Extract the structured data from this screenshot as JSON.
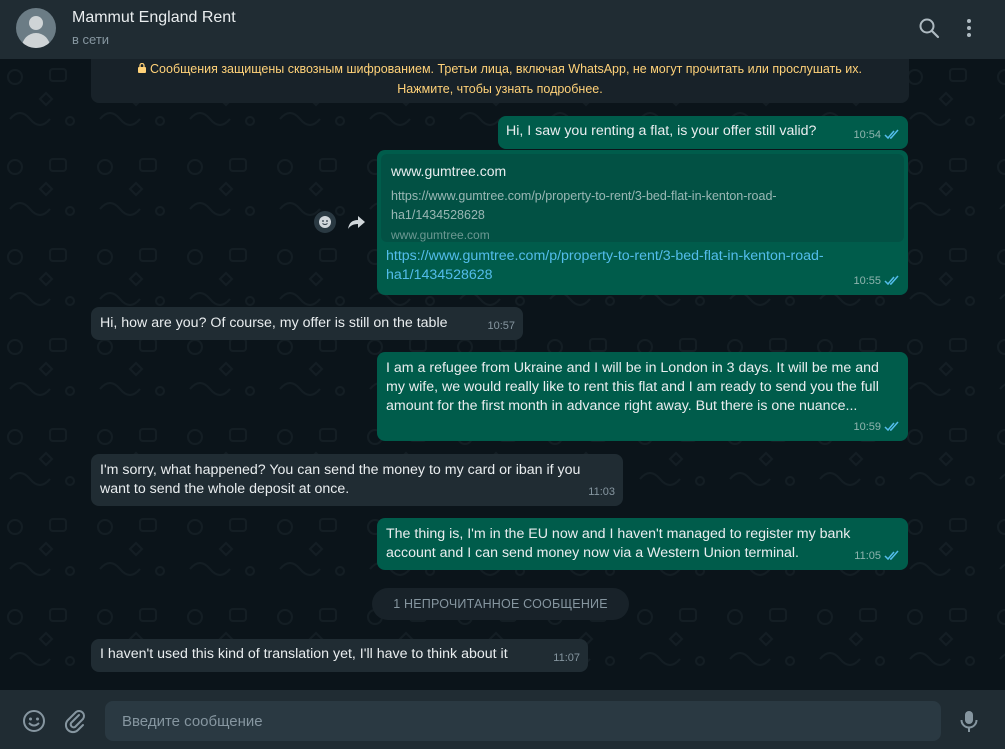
{
  "header": {
    "contact_name": "Mammut England Rent",
    "contact_status": "в сети",
    "icons": [
      "search-icon",
      "menu-icon"
    ]
  },
  "chat": {
    "encryption_notice_line1": "Сообщения защищены сквозным шифрованием. Третьи лица, включая WhatsApp, не могут прочитать или прослушать их.",
    "encryption_notice_line2": "Нажмите, чтобы узнать подробнее.",
    "messages": [
      {
        "direction": "out",
        "text": "Hi, I saw you renting a flat, is your offer still valid?",
        "time": "10:54"
      },
      {
        "direction": "out",
        "type": "link",
        "preview_title": "www.gumtree.com",
        "preview_desc_line1": "https://www.gumtree.com/p/property-to-rent/3-bed-flat-in-kenton-road-",
        "preview_desc_line2": "ha1/1434528628",
        "preview_host": "www.gumtree.com",
        "url_line1": "https://www.gumtree.com/p/property-to-rent/3-bed-flat-in-kenton-road-",
        "url_line2": "ha1/1434528628",
        "time": "10:55"
      },
      {
        "direction": "in",
        "text": "Hi, how are you? Of course, my offer is still on the table",
        "time": "10:57"
      },
      {
        "direction": "out",
        "line1": "I am a refugee from Ukraine and I will be in London in 3 days. It will be me and",
        "line2": "my wife, we would really like to rent this flat and I am ready to send you the full",
        "line3": "amount for the first month in advance right away. But there is one nuance...",
        "time": "10:59"
      },
      {
        "direction": "in",
        "line1": "I'm sorry, what happened? You can send the money to my card or iban if you",
        "line2": "want to send the whole deposit at once.",
        "time": "11:03"
      },
      {
        "direction": "out",
        "line1": "The thing is, I'm in the EU now and I haven't managed to register my bank",
        "line2": "account and I can send money now via a Western Union terminal.",
        "time": "11:05"
      },
      {
        "direction": "in",
        "text": "I haven't used this kind of translation yet, I'll have to think about it",
        "time": "11:07"
      }
    ],
    "unread_divider": "1 НЕПРОЧИТАННОЕ СООБЩЕНИЕ"
  },
  "footer": {
    "placeholder": "Введите сообщение",
    "icons": [
      "emoji-icon",
      "attach-icon",
      "microphone-icon"
    ]
  },
  "colors": {
    "outgoing_bubble": "#005c4b",
    "incoming_bubble": "#202c33",
    "chat_background": "#0b141a",
    "panel": "#202c33",
    "read_ticks": "#53bdeb",
    "link": "#53bdeb",
    "notice_text": "#ffd279"
  }
}
